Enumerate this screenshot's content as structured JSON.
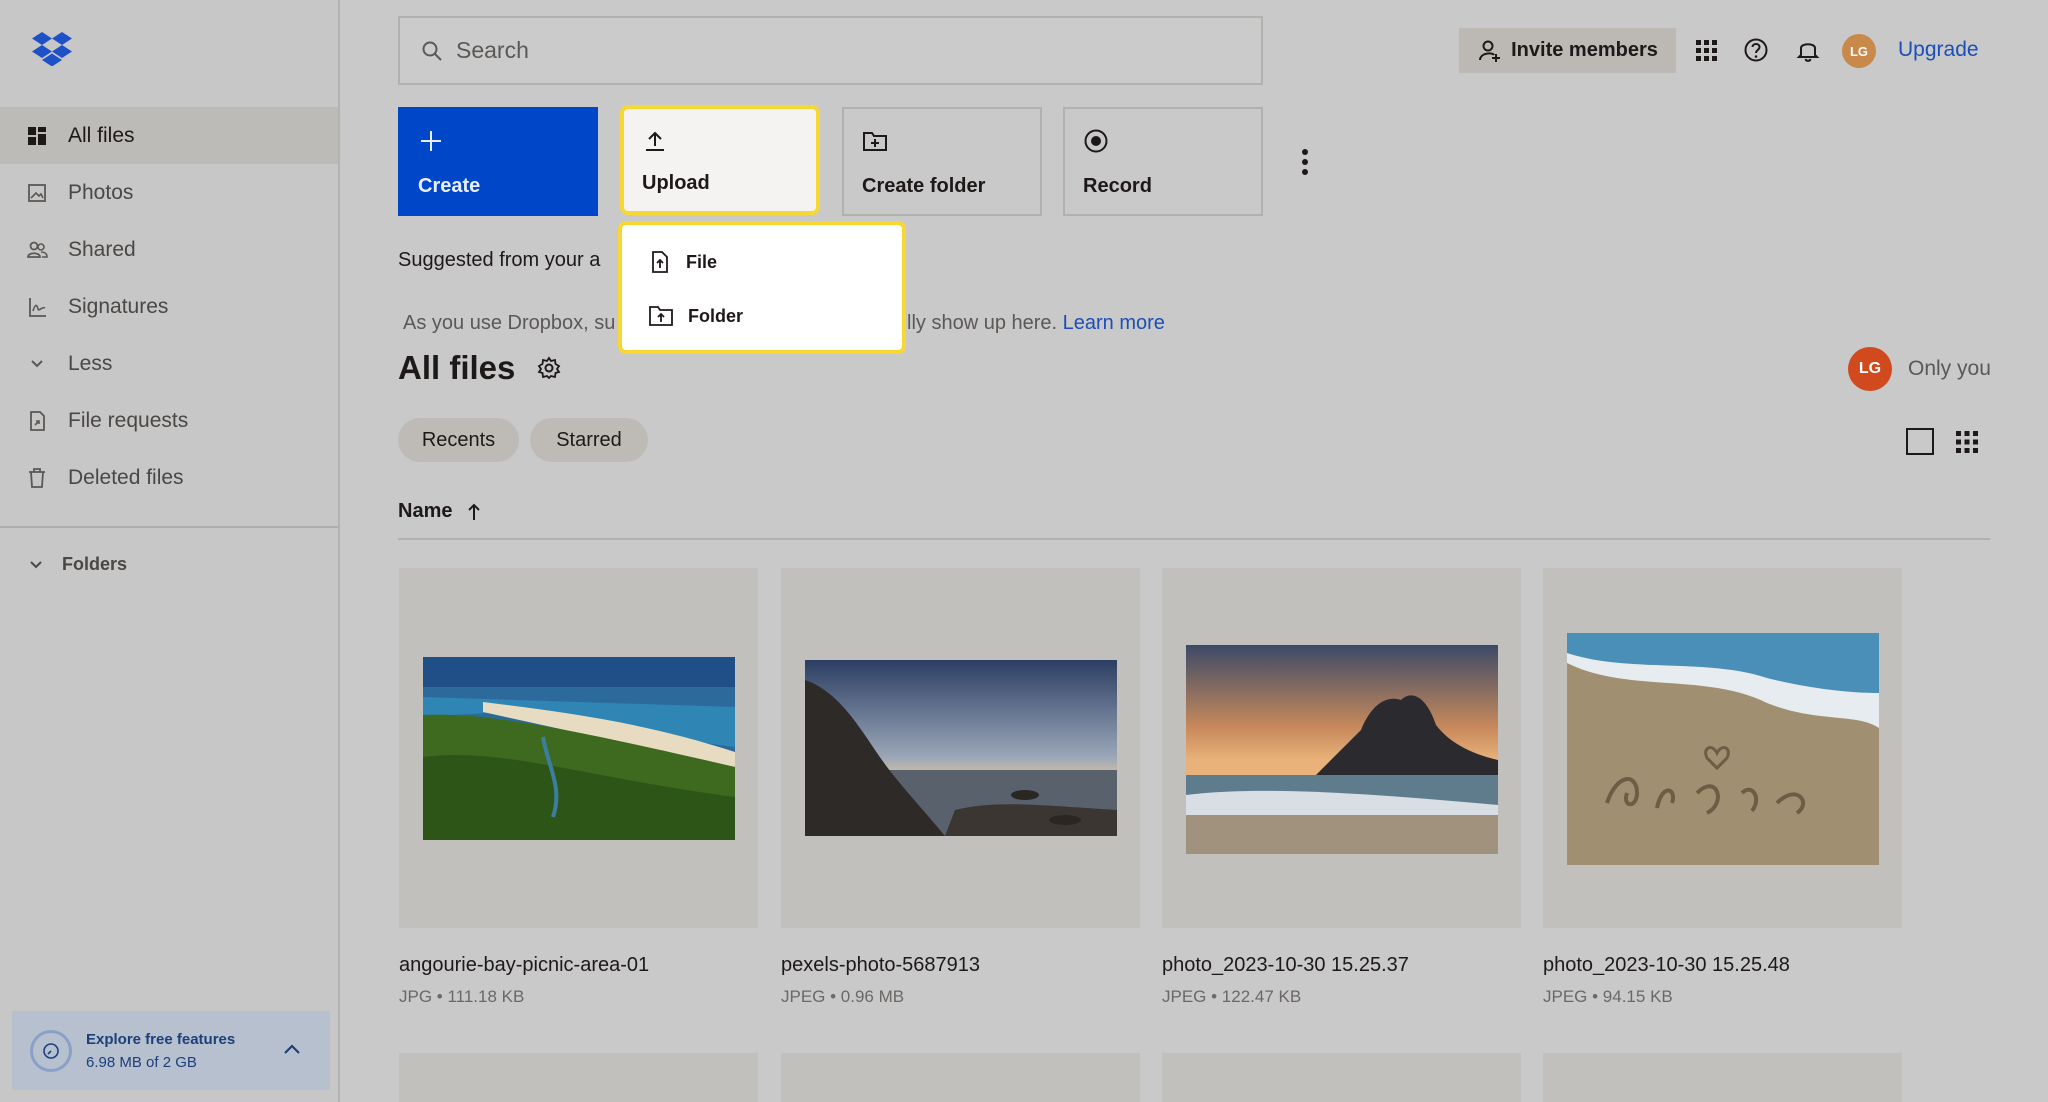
{
  "colors": {
    "accent": "#0046c9",
    "highlight": "#f7d833",
    "link": "#1b4fb7"
  },
  "sidebar": {
    "items": [
      {
        "label": "All files",
        "icon": "all-files-icon"
      },
      {
        "label": "Photos",
        "icon": "photos-icon"
      },
      {
        "label": "Shared",
        "icon": "shared-icon"
      },
      {
        "label": "Signatures",
        "icon": "signatures-icon"
      },
      {
        "label": "Less",
        "icon": "chevron-down-icon"
      },
      {
        "label": "File requests",
        "icon": "file-requests-icon"
      },
      {
        "label": "Deleted files",
        "icon": "trash-icon"
      }
    ],
    "folders_label": "Folders",
    "explore": {
      "title": "Explore free features",
      "usage": "6.98 MB of 2 GB"
    }
  },
  "header": {
    "search_placeholder": "Search",
    "invite_label": "Invite members",
    "avatar_initials": "LG",
    "upgrade_label": "Upgrade"
  },
  "actions": {
    "create": "Create",
    "upload": "Upload",
    "create_folder": "Create folder",
    "record": "Record"
  },
  "upload_menu": {
    "file": "File",
    "folder": "Folder"
  },
  "suggested": {
    "title": "Suggested from your a",
    "hint_left": "As you use Dropbox, su",
    "hint_right": "lly show up here.",
    "learn_more": "Learn more"
  },
  "main": {
    "title": "All files",
    "owner_initials": "LG",
    "owner_label": "Only you",
    "chips": {
      "recents": "Recents",
      "starred": "Starred"
    },
    "column_name": "Name"
  },
  "files": [
    {
      "name": "angourie-bay-picnic-area-01",
      "meta": "JPG • 111.18 KB"
    },
    {
      "name": "pexels-photo-5687913",
      "meta": "JPEG • 0.96 MB"
    },
    {
      "name": "photo_2023-10-30 15.25.37",
      "meta": "JPEG • 122.47 KB"
    },
    {
      "name": "photo_2023-10-30 15.25.48",
      "meta": "JPEG • 94.15 KB"
    }
  ]
}
